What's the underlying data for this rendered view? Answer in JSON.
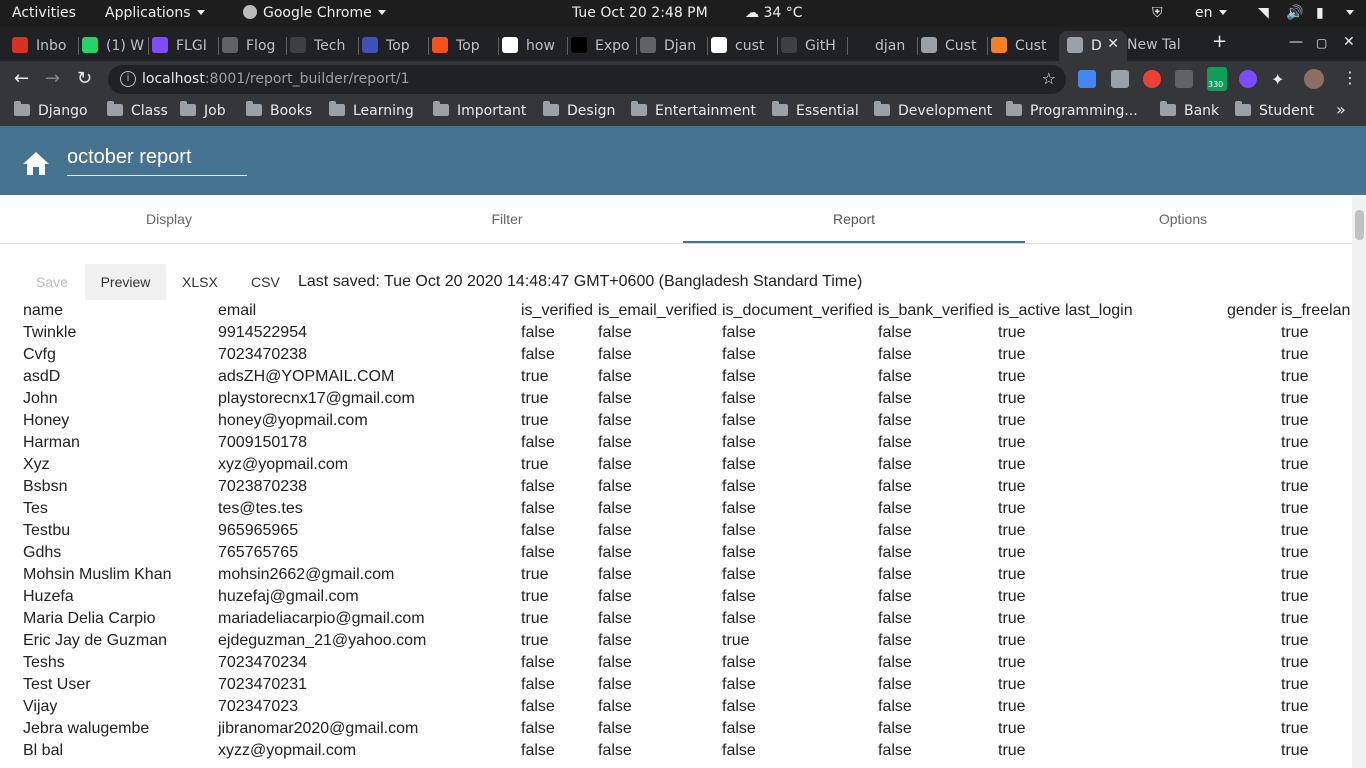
{
  "system_bar": {
    "activities": "Activities",
    "applications": "Applications",
    "active_app": "Google Chrome",
    "clock": "Tue Oct 20   2:48 PM",
    "weather": "34 °C",
    "language": "en"
  },
  "browser": {
    "tabs": [
      {
        "label": "Inbo",
        "icon": "gmail-icon",
        "color": "#d93025"
      },
      {
        "label": "(1) W",
        "icon": "whatsapp-icon",
        "color": "#25d366"
      },
      {
        "label": "FLGI",
        "icon": "flgi-icon",
        "color": "#7c4dff"
      },
      {
        "label": "Flog",
        "icon": "globe-icon",
        "color": "#5f6368"
      },
      {
        "label": "Tech",
        "icon": "tech-icon",
        "color": "#3c4043"
      },
      {
        "label": "Top",
        "icon": "top-icon",
        "color": "#3f51b5"
      },
      {
        "label": "Top",
        "icon": "top-orange-icon",
        "color": "#f4511e"
      },
      {
        "label": "how",
        "icon": "google-icon",
        "color": "#ffffff"
      },
      {
        "label": "Expo",
        "icon": "medium-icon",
        "color": "#000000"
      },
      {
        "label": "Djan",
        "icon": "globe-icon",
        "color": "#5f6368"
      },
      {
        "label": "cust",
        "icon": "google-icon",
        "color": "#ffffff"
      },
      {
        "label": "GitH",
        "icon": "github-icon",
        "color": "#3c4043"
      },
      {
        "label": "djan",
        "icon": "doc-icon",
        "color": "#202124"
      },
      {
        "label": "Cust",
        "icon": "grid-icon",
        "color": "#9aa0a6"
      },
      {
        "label": "Cust",
        "icon": "stackoverflow-icon",
        "color": "#f48024"
      },
      {
        "label": "D",
        "icon": "globe-icon",
        "color": "#9aa0a6",
        "active": true
      },
      {
        "label": "New Tal",
        "icon": "",
        "color": ""
      }
    ],
    "new_tab": "+",
    "url_host": "localhost",
    "url_path": ":8001/report_builder/report/1",
    "bookmarks": [
      "Django",
      "Class",
      "Job",
      "Books",
      "Learning",
      "Important",
      "Design",
      "Entertainment",
      "Essential",
      "Development",
      "Programming...",
      "Bank",
      "Student"
    ],
    "more_bookmarks": "»",
    "extension_badge": "330"
  },
  "app": {
    "report_name": "october report",
    "tabs": [
      "Display",
      "Filter",
      "Report",
      "Options"
    ],
    "active_tab": "Report",
    "actions": {
      "save": "Save",
      "preview": "Preview",
      "xlsx": "XLSX",
      "csv": "CSV"
    },
    "last_saved": "Last saved: Tue Oct 20 2020 14:48:47 GMT+0600 (Bangladesh Standard Time)",
    "accent": "#44728f"
  },
  "table": {
    "headers": [
      "name",
      "email",
      "is_verified",
      "is_email_verified",
      "is_document_verified",
      "is_bank_verified",
      "is_active",
      "last_login",
      "gender",
      "is_freelan"
    ],
    "rows": [
      [
        "Twinkle",
        "9914522954",
        "false",
        "false",
        "false",
        "false",
        "true",
        "",
        "",
        "true"
      ],
      [
        "Cvfg",
        "7023470238",
        "false",
        "false",
        "false",
        "false",
        "true",
        "",
        "",
        "true"
      ],
      [
        "asdD",
        "adsZH@YOPMAIL.COM",
        "true",
        "false",
        "false",
        "false",
        "true",
        "",
        "",
        "true"
      ],
      [
        "John",
        "playstorecnx17@gmail.com",
        "true",
        "false",
        "false",
        "false",
        "true",
        "",
        "",
        "true"
      ],
      [
        "Honey",
        "honey@yopmail.com",
        "true",
        "false",
        "false",
        "false",
        "true",
        "",
        "",
        "true"
      ],
      [
        "Harman",
        "7009150178",
        "false",
        "false",
        "false",
        "false",
        "true",
        "",
        "",
        "true"
      ],
      [
        "Xyz",
        "xyz@yopmail.com",
        "true",
        "false",
        "false",
        "false",
        "true",
        "",
        "",
        "true"
      ],
      [
        "Bsbsn",
        "7023870238",
        "false",
        "false",
        "false",
        "false",
        "true",
        "",
        "",
        "true"
      ],
      [
        "Tes",
        "tes@tes.tes",
        "false",
        "false",
        "false",
        "false",
        "true",
        "",
        "",
        "true"
      ],
      [
        "Testbu",
        "965965965",
        "false",
        "false",
        "false",
        "false",
        "true",
        "",
        "",
        "true"
      ],
      [
        "Gdhs",
        "765765765",
        "false",
        "false",
        "false",
        "false",
        "true",
        "",
        "",
        "true"
      ],
      [
        "Mohsin Muslim Khan",
        "mohsin2662@gmail.com",
        "true",
        "false",
        "false",
        "false",
        "true",
        "",
        "",
        "true"
      ],
      [
        "Huzefa",
        "huzefaj@gmail.com",
        "true",
        "false",
        "false",
        "false",
        "true",
        "",
        "",
        "true"
      ],
      [
        "Maria Delia Carpio",
        "mariadeliacarpio@gmail.com",
        "true",
        "false",
        "false",
        "false",
        "true",
        "",
        "",
        "true"
      ],
      [
        "Eric Jay de Guzman",
        "ejdeguzman_21@yahoo.com",
        "true",
        "false",
        "true",
        "false",
        "true",
        "",
        "",
        "true"
      ],
      [
        "Teshs",
        "7023470234",
        "false",
        "false",
        "false",
        "false",
        "true",
        "",
        "",
        "true"
      ],
      [
        "Test User",
        "7023470231",
        "false",
        "false",
        "false",
        "false",
        "true",
        "",
        "",
        "true"
      ],
      [
        "Vijay",
        "702347023",
        "false",
        "false",
        "false",
        "false",
        "true",
        "",
        "",
        "true"
      ],
      [
        "Jebra walugembe",
        "jibranomar2020@gmail.com",
        "false",
        "false",
        "false",
        "false",
        "true",
        "",
        "",
        "true"
      ],
      [
        "Bl bal",
        "xyzz@yopmail.com",
        "false",
        "false",
        "false",
        "false",
        "true",
        "",
        "",
        "true"
      ]
    ]
  }
}
